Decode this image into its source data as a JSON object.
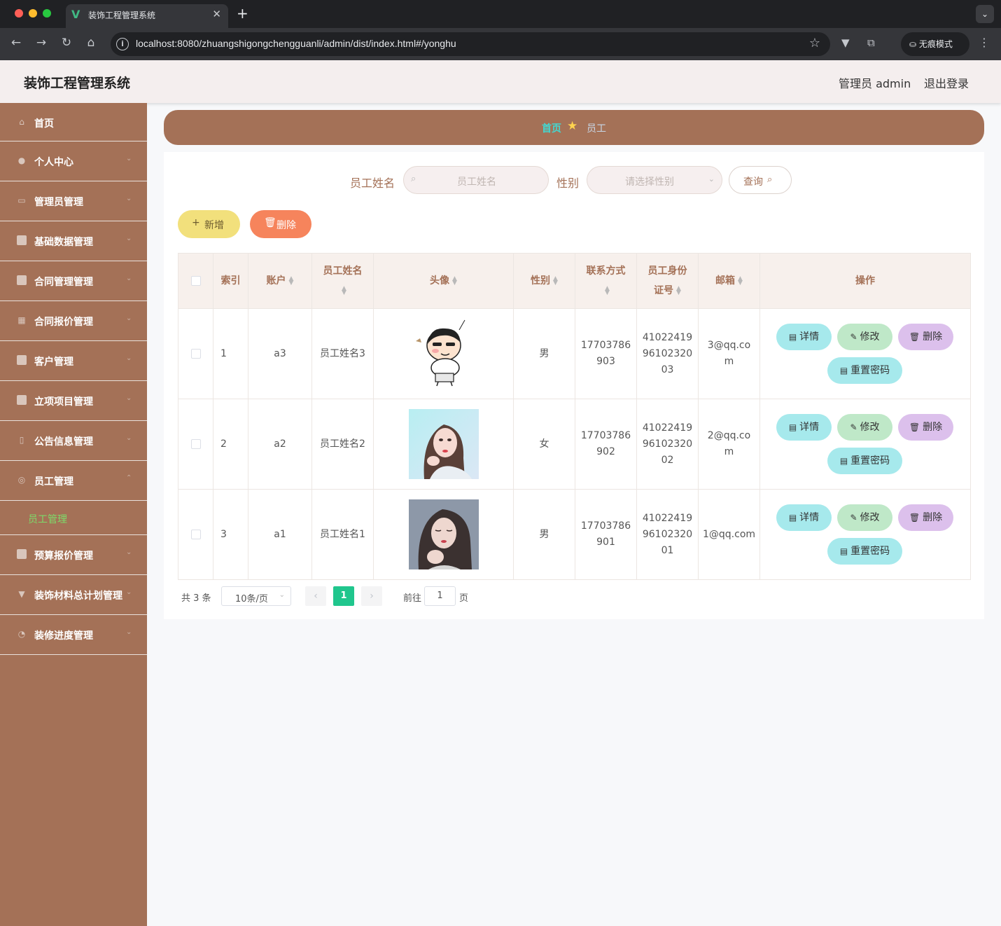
{
  "browser": {
    "tab_title": "装饰工程管理系统",
    "url": "localhost:8080/zhuangshigongchengguanli/admin/dist/index.html#/yonghu",
    "incognito_label": "无痕模式"
  },
  "header": {
    "title": "装饰工程管理系统",
    "user": "管理员 admin",
    "logout": "退出登录"
  },
  "sidebar": {
    "items": [
      {
        "label": "首页",
        "icon": "home-icon"
      },
      {
        "label": "个人中心",
        "icon": "user-icon"
      },
      {
        "label": "管理员管理",
        "icon": "chat-icon"
      },
      {
        "label": "基础数据管理",
        "icon": "briefcase-icon"
      },
      {
        "label": "合同管理管理",
        "icon": "camera-icon"
      },
      {
        "label": "合同报价管理",
        "icon": "grid-icon"
      },
      {
        "label": "客户管理",
        "icon": "message-icon"
      },
      {
        "label": "立项项目管理",
        "icon": "monitor-icon"
      },
      {
        "label": "公告信息管理",
        "icon": "phone-icon"
      },
      {
        "label": "员工管理",
        "icon": "circle-icon"
      },
      {
        "label": "预算报价管理",
        "icon": "document-icon"
      },
      {
        "label": "装饰材料总计划管理",
        "icon": "cup-icon"
      },
      {
        "label": "装修进度管理",
        "icon": "dashboard-icon"
      }
    ],
    "active_sub": "员工管理"
  },
  "breadcrumb": {
    "home": "首页",
    "current": "员工"
  },
  "search": {
    "name_label": "员工姓名",
    "name_placeholder": "员工姓名",
    "gender_label": "性别",
    "gender_placeholder": "请选择性别",
    "query_label": "查询"
  },
  "actions": {
    "add": "新增",
    "delete": "删除"
  },
  "table": {
    "headers": {
      "index": "索引",
      "account": "账户",
      "name": "员工姓名",
      "avatar": "头像",
      "gender": "性别",
      "phone": "联系方式",
      "idcard_1": "员工身份",
      "idcard_2": "证号",
      "email": "邮箱",
      "ops": "操作"
    },
    "rows": [
      {
        "index": "1",
        "account": "a3",
        "name": "员工姓名3",
        "gender": "男",
        "phone_1": "17703786",
        "phone_2": "903",
        "id_1": "41022419",
        "id_2": "96102320",
        "id_3": "03",
        "email_1": "3@qq.co",
        "email_2": "m"
      },
      {
        "index": "2",
        "account": "a2",
        "name": "员工姓名2",
        "gender": "女",
        "phone_1": "17703786",
        "phone_2": "902",
        "id_1": "41022419",
        "id_2": "96102320",
        "id_3": "02",
        "email_1": "2@qq.co",
        "email_2": "m"
      },
      {
        "index": "3",
        "account": "a1",
        "name": "员工姓名1",
        "gender": "男",
        "phone_1": "17703786",
        "phone_2": "901",
        "id_1": "41022419",
        "id_2": "96102320",
        "id_3": "01",
        "email_1": "1@qq.com",
        "email_2": ""
      }
    ],
    "ops": {
      "detail": "详情",
      "edit": "修改",
      "remove": "删除",
      "reset": "重置密码"
    }
  },
  "pagination": {
    "total": "共 3 条",
    "page_size": "10条/页",
    "current": "1",
    "goto_label": "前往",
    "goto_value": "1",
    "goto_unit": "页"
  }
}
